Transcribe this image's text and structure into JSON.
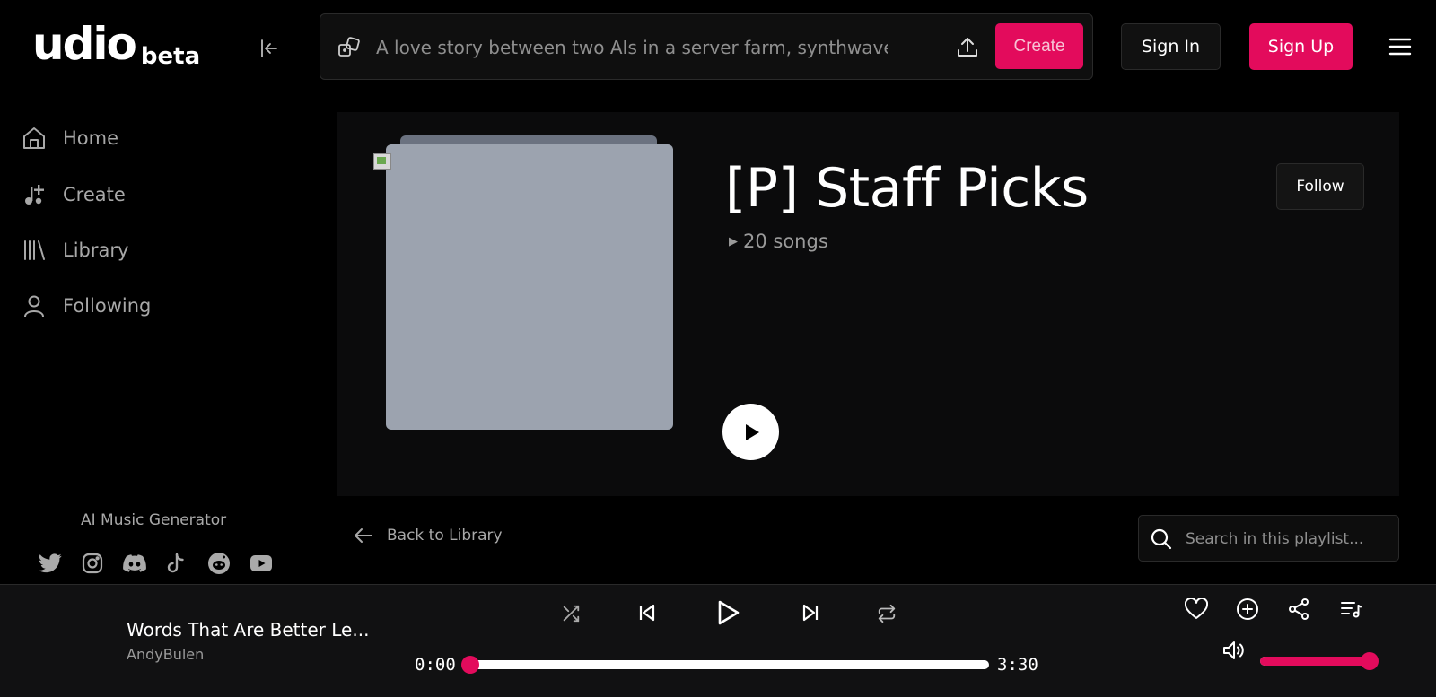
{
  "brand": {
    "name": "udio",
    "tag": "beta"
  },
  "header": {
    "prompt_placeholder": "A love story between two AIs in a server farm, synthwave",
    "create_label": "Create",
    "sign_in_label": "Sign In",
    "sign_up_label": "Sign Up"
  },
  "sidebar": {
    "items": [
      {
        "label": "Home",
        "icon": "home-icon"
      },
      {
        "label": "Create",
        "icon": "music-plus-icon"
      },
      {
        "label": "Library",
        "icon": "library-icon"
      },
      {
        "label": "Following",
        "icon": "user-icon"
      }
    ],
    "tagline": "AI Music Generator",
    "socials": [
      "twitter-icon",
      "instagram-icon",
      "discord-icon",
      "tiktok-icon",
      "reddit-icon",
      "youtube-icon"
    ]
  },
  "playlist": {
    "title": "[P] Staff Picks",
    "song_count": "20 songs",
    "follow_label": "Follow",
    "back_label": "Back to Library",
    "search_placeholder": "Search in this playlist..."
  },
  "player": {
    "track_title": "Words That Are Better Le...",
    "artist": "AndyBulen",
    "current_time": "0:00",
    "total_time": "3:30",
    "progress_fraction": 0.0,
    "volume_fraction": 1.0
  },
  "colors": {
    "accent": "#e30b5c",
    "background": "#000000",
    "surface": "#111112",
    "cover_placeholder": "#9ca3af"
  }
}
